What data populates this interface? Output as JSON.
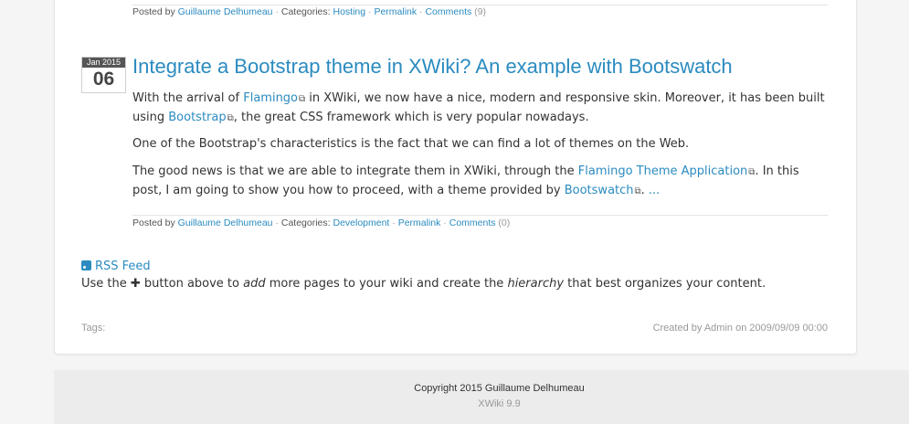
{
  "posts": [
    {
      "meta": {
        "posted_by": "Posted by",
        "author": "Guillaume Delhumeau",
        "sep1": " · Categories: ",
        "category": "Hosting",
        "permalink": "Permalink",
        "comments": "Comments",
        "comments_count": "(9)"
      }
    },
    {
      "date_month": "Jan 2015",
      "date_day": "06",
      "title": "Integrate a Bootstrap theme in XWiki? An example with Bootswatch",
      "p1_a": "With the arrival of ",
      "p1_link1": "Flamingo",
      "p1_b": " in XWiki, we now have a nice, modern and responsive skin. Moreover, it has been built using ",
      "p1_link2": "Bootstrap",
      "p1_c": ", the great CSS framework which is very popular nowadays.",
      "p2": "One of the Bootstrap's characteristics is the fact that we can find a lot of themes on the Web.",
      "p3_a": "The good news is that we are able to integrate them in XWiki, through the ",
      "p3_link1": "Flamingo Theme Application",
      "p3_b": ". In this post, I am going to show you how to proceed, with a theme provided by ",
      "p3_link2": "Bootswatch",
      "p3_c": ". ",
      "p3_more": "...",
      "meta": {
        "posted_by": "Posted by",
        "author": "Guillaume Delhumeau",
        "sep1": " · Categories: ",
        "category": "Development",
        "permalink": "Permalink",
        "comments": "Comments",
        "comments_count": "(0)"
      }
    }
  ],
  "rss": {
    "label": "RSS Feed",
    "icon": "rss-icon"
  },
  "hint": {
    "a": "Use the ",
    "icon": "plus-icon",
    "b": " button above to ",
    "em1": "add",
    "c": " more pages to your wiki and create the ",
    "em2": "hierarchy",
    "d": " that best organizes your content."
  },
  "tags_label": "Tags:",
  "created": "Created by Admin on 2009/09/09 00:00",
  "footer": {
    "copyright": "Copyright 2015 Guillaume Delhumeau",
    "version": "XWiki 9.9"
  },
  "colors": {
    "link": "#2b8bc0",
    "badge_month_bg": "#555555",
    "footer_bg": "#ececec"
  }
}
